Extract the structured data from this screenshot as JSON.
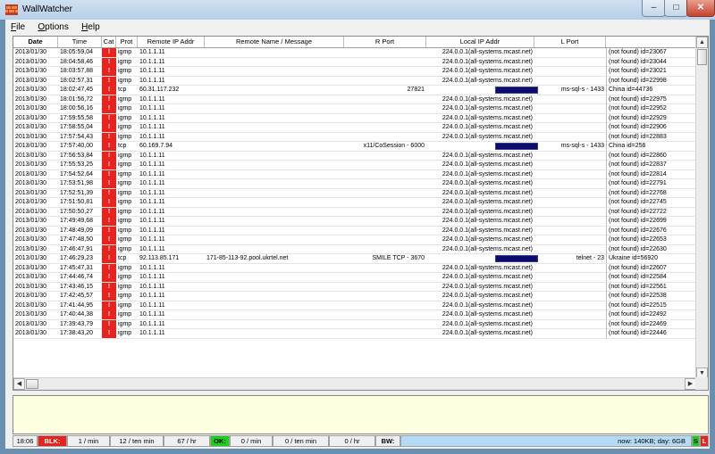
{
  "window": {
    "title": "WallWatcher",
    "minimize": "–",
    "maximize": "□",
    "close": "✕"
  },
  "menu": [
    "File",
    "Options",
    "Help"
  ],
  "columns": [
    "Date",
    "Time",
    "Cat",
    "Prot",
    "Remote IP Addr",
    "Remote Name / Message",
    "R Port",
    "Local IP Addr",
    "L Port",
    ""
  ],
  "rows": [
    {
      "date": "2013/01/30",
      "time": "18:05:59,04",
      "cat": "!",
      "prot": "igmp",
      "rip": "10.1.1.11",
      "rname": "",
      "rport": "",
      "lip": "224.0.0.1(all-systems.mcast.net)",
      "lport": "",
      "info": "(not found)  id=23067",
      "redacted": false
    },
    {
      "date": "2013/01/30",
      "time": "18:04:58,46",
      "cat": "!",
      "prot": "igmp",
      "rip": "10.1.1.11",
      "rname": "",
      "rport": "",
      "lip": "224.0.0.1(all-systems.mcast.net)",
      "lport": "",
      "info": "(not found)  id=23044",
      "redacted": false
    },
    {
      "date": "2013/01/30",
      "time": "18:03:57,88",
      "cat": "!",
      "prot": "igmp",
      "rip": "10.1.1.11",
      "rname": "",
      "rport": "",
      "lip": "224.0.0.1(all-systems.mcast.net)",
      "lport": "",
      "info": "(not found)  id=23021",
      "redacted": false
    },
    {
      "date": "2013/01/30",
      "time": "18:02:57,31",
      "cat": "!",
      "prot": "igmp",
      "rip": "10.1.1.11",
      "rname": "",
      "rport": "",
      "lip": "224.0.0.1(all-systems.mcast.net)",
      "lport": "",
      "info": "(not found)  id=22998",
      "redacted": false
    },
    {
      "date": "2013/01/30",
      "time": "18:02:47,45",
      "cat": "!",
      "prot": "tcp",
      "rip": "60.31.117.232",
      "rname": "",
      "rport": "27821",
      "lip": "",
      "lport": "ms-sql-s - 1433",
      "info": "China  id=44736",
      "redacted": true
    },
    {
      "date": "2013/01/30",
      "time": "18:01:56,72",
      "cat": "!",
      "prot": "igmp",
      "rip": "10.1.1.11",
      "rname": "",
      "rport": "",
      "lip": "224.0.0.1(all-systems.mcast.net)",
      "lport": "",
      "info": "(not found)  id=22975",
      "redacted": false
    },
    {
      "date": "2013/01/30",
      "time": "18:00:56,16",
      "cat": "!",
      "prot": "igmp",
      "rip": "10.1.1.11",
      "rname": "",
      "rport": "",
      "lip": "224.0.0.1(all-systems.mcast.net)",
      "lport": "",
      "info": "(not found)  id=22952",
      "redacted": false
    },
    {
      "date": "2013/01/30",
      "time": "17:59:55,58",
      "cat": "!",
      "prot": "igmp",
      "rip": "10.1.1.11",
      "rname": "",
      "rport": "",
      "lip": "224.0.0.1(all-systems.mcast.net)",
      "lport": "",
      "info": "(not found)  id=22929",
      "redacted": false
    },
    {
      "date": "2013/01/30",
      "time": "17:58:55,04",
      "cat": "!",
      "prot": "igmp",
      "rip": "10.1.1.11",
      "rname": "",
      "rport": "",
      "lip": "224.0.0.1(all-systems.mcast.net)",
      "lport": "",
      "info": "(not found)  id=22906",
      "redacted": false
    },
    {
      "date": "2013/01/30",
      "time": "17:57:54,43",
      "cat": "!",
      "prot": "igmp",
      "rip": "10.1.1.11",
      "rname": "",
      "rport": "",
      "lip": "224.0.0.1(all-systems.mcast.net)",
      "lport": "",
      "info": "(not found)  id=22883",
      "redacted": false
    },
    {
      "date": "2013/01/30",
      "time": "17:57:40,00",
      "cat": "!",
      "prot": "tcp",
      "rip": "60.169.7.94",
      "rname": "",
      "rport": "x11/CoSession - 6000",
      "lip": "",
      "lport": "ms-sql-s - 1433",
      "info": "China  id=256",
      "redacted": true
    },
    {
      "date": "2013/01/30",
      "time": "17:56:53,84",
      "cat": "!",
      "prot": "igmp",
      "rip": "10.1.1.11",
      "rname": "",
      "rport": "",
      "lip": "224.0.0.1(all-systems.mcast.net)",
      "lport": "",
      "info": "(not found)  id=22860",
      "redacted": false
    },
    {
      "date": "2013/01/30",
      "time": "17:55:53,25",
      "cat": "!",
      "prot": "igmp",
      "rip": "10.1.1.11",
      "rname": "",
      "rport": "",
      "lip": "224.0.0.1(all-systems.mcast.net)",
      "lport": "",
      "info": "(not found)  id=22837",
      "redacted": false
    },
    {
      "date": "2013/01/30",
      "time": "17:54:52,64",
      "cat": "!",
      "prot": "igmp",
      "rip": "10.1.1.11",
      "rname": "",
      "rport": "",
      "lip": "224.0.0.1(all-systems.mcast.net)",
      "lport": "",
      "info": "(not found)  id=22814",
      "redacted": false
    },
    {
      "date": "2013/01/30",
      "time": "17:53:51,98",
      "cat": "!",
      "prot": "igmp",
      "rip": "10.1.1.11",
      "rname": "",
      "rport": "",
      "lip": "224.0.0.1(all-systems.mcast.net)",
      "lport": "",
      "info": "(not found)  id=22791",
      "redacted": false
    },
    {
      "date": "2013/01/30",
      "time": "17:52:51,39",
      "cat": "!",
      "prot": "igmp",
      "rip": "10.1.1.11",
      "rname": "",
      "rport": "",
      "lip": "224.0.0.1(all-systems.mcast.net)",
      "lport": "",
      "info": "(not found)  id=22768",
      "redacted": false
    },
    {
      "date": "2013/01/30",
      "time": "17:51:50,81",
      "cat": "!",
      "prot": "igmp",
      "rip": "10.1.1.11",
      "rname": "",
      "rport": "",
      "lip": "224.0.0.1(all-systems.mcast.net)",
      "lport": "",
      "info": "(not found)  id=22745",
      "redacted": false
    },
    {
      "date": "2013/01/30",
      "time": "17:50:50,27",
      "cat": "!",
      "prot": "igmp",
      "rip": "10.1.1.11",
      "rname": "",
      "rport": "",
      "lip": "224.0.0.1(all-systems.mcast.net)",
      "lport": "",
      "info": "(not found)  id=22722",
      "redacted": false
    },
    {
      "date": "2013/01/30",
      "time": "17:49:49,68",
      "cat": "!",
      "prot": "igmp",
      "rip": "10.1.1.11",
      "rname": "",
      "rport": "",
      "lip": "224.0.0.1(all-systems.mcast.net)",
      "lport": "",
      "info": "(not found)  id=22699",
      "redacted": false
    },
    {
      "date": "2013/01/30",
      "time": "17:48:49,09",
      "cat": "!",
      "prot": "igmp",
      "rip": "10.1.1.11",
      "rname": "",
      "rport": "",
      "lip": "224.0.0.1(all-systems.mcast.net)",
      "lport": "",
      "info": "(not found)  id=22676",
      "redacted": false
    },
    {
      "date": "2013/01/30",
      "time": "17:47:48,50",
      "cat": "!",
      "prot": "igmp",
      "rip": "10.1.1.11",
      "rname": "",
      "rport": "",
      "lip": "224.0.0.1(all-systems.mcast.net)",
      "lport": "",
      "info": "(not found)  id=22653",
      "redacted": false
    },
    {
      "date": "2013/01/30",
      "time": "17:46:47,91",
      "cat": "!",
      "prot": "igmp",
      "rip": "10.1.1.11",
      "rname": "",
      "rport": "",
      "lip": "224.0.0.1(all-systems.mcast.net)",
      "lport": "",
      "info": "(not found)  id=22630",
      "redacted": false
    },
    {
      "date": "2013/01/30",
      "time": "17:46:29,23",
      "cat": "!",
      "prot": "tcp",
      "rip": "92.113.85.171",
      "rname": "171-85-113-92.pool.ukrtel.net",
      "rport": "SMILE TCP - 3670",
      "lip": "",
      "lport": "telnet - 23",
      "info": "Ukraine  id=56920",
      "redacted": true
    },
    {
      "date": "2013/01/30",
      "time": "17:45:47,31",
      "cat": "!",
      "prot": "igmp",
      "rip": "10.1.1.11",
      "rname": "",
      "rport": "",
      "lip": "224.0.0.1(all-systems.mcast.net)",
      "lport": "",
      "info": "(not found)  id=22607",
      "redacted": false
    },
    {
      "date": "2013/01/30",
      "time": "17:44:46,74",
      "cat": "!",
      "prot": "igmp",
      "rip": "10.1.1.11",
      "rname": "",
      "rport": "",
      "lip": "224.0.0.1(all-systems.mcast.net)",
      "lport": "",
      "info": "(not found)  id=22584",
      "redacted": false
    },
    {
      "date": "2013/01/30",
      "time": "17:43:46,15",
      "cat": "!",
      "prot": "igmp",
      "rip": "10.1.1.11",
      "rname": "",
      "rport": "",
      "lip": "224.0.0.1(all-systems.mcast.net)",
      "lport": "",
      "info": "(not found)  id=22561",
      "redacted": false
    },
    {
      "date": "2013/01/30",
      "time": "17:42:45,57",
      "cat": "!",
      "prot": "igmp",
      "rip": "10.1.1.11",
      "rname": "",
      "rport": "",
      "lip": "224.0.0.1(all-systems.mcast.net)",
      "lport": "",
      "info": "(not found)  id=22538",
      "redacted": false
    },
    {
      "date": "2013/01/30",
      "time": "17:41:44,95",
      "cat": "!",
      "prot": "igmp",
      "rip": "10.1.1.11",
      "rname": "",
      "rport": "",
      "lip": "224.0.0.1(all-systems.mcast.net)",
      "lport": "",
      "info": "(not found)  id=22515",
      "redacted": false
    },
    {
      "date": "2013/01/30",
      "time": "17:40:44,38",
      "cat": "!",
      "prot": "igmp",
      "rip": "10.1.1.11",
      "rname": "",
      "rport": "",
      "lip": "224.0.0.1(all-systems.mcast.net)",
      "lport": "",
      "info": "(not found)  id=22492",
      "redacted": false
    },
    {
      "date": "2013/01/30",
      "time": "17:39:43,79",
      "cat": "!",
      "prot": "igmp",
      "rip": "10.1.1.11",
      "rname": "",
      "rport": "",
      "lip": "224.0.0.1(all-systems.mcast.net)",
      "lport": "",
      "info": "(not found)  id=22469",
      "redacted": false
    },
    {
      "date": "2013/01/30",
      "time": "17:38:43,20",
      "cat": "!",
      "prot": "igmp",
      "rip": "10.1.1.11",
      "rname": "",
      "rport": "",
      "lip": "224.0.0.1(all-systems.mcast.net)",
      "lport": "",
      "info": "(not found)  id=22446",
      "redacted": false
    }
  ],
  "status": {
    "time": "18:06",
    "blk_label": "BLK:",
    "per_min": "1 / min",
    "per_ten": "12 / ten min",
    "per_hr": "67 / hr",
    "ok_label": "OK:",
    "ok_min": "0 / min",
    "ok_ten": "0 / ten min",
    "ok_hr": "0 / hr",
    "bw_label": "BW:",
    "bw_value": "now: 140KB; day: 6GB",
    "s_label": "S",
    "l_label": "L"
  },
  "colors": {
    "blocked": "#e8221c",
    "ok": "#19d119",
    "bandwidth": "#b3dbf6",
    "message_pane": "#ffffe1",
    "redaction": "#0c0c6a"
  },
  "icons": {
    "app": "wallwatcher-brick-icon",
    "scroll_up": "arrow-up-icon",
    "scroll_down": "arrow-down-icon",
    "scroll_left": "arrow-left-icon",
    "scroll_right": "arrow-right-icon"
  }
}
